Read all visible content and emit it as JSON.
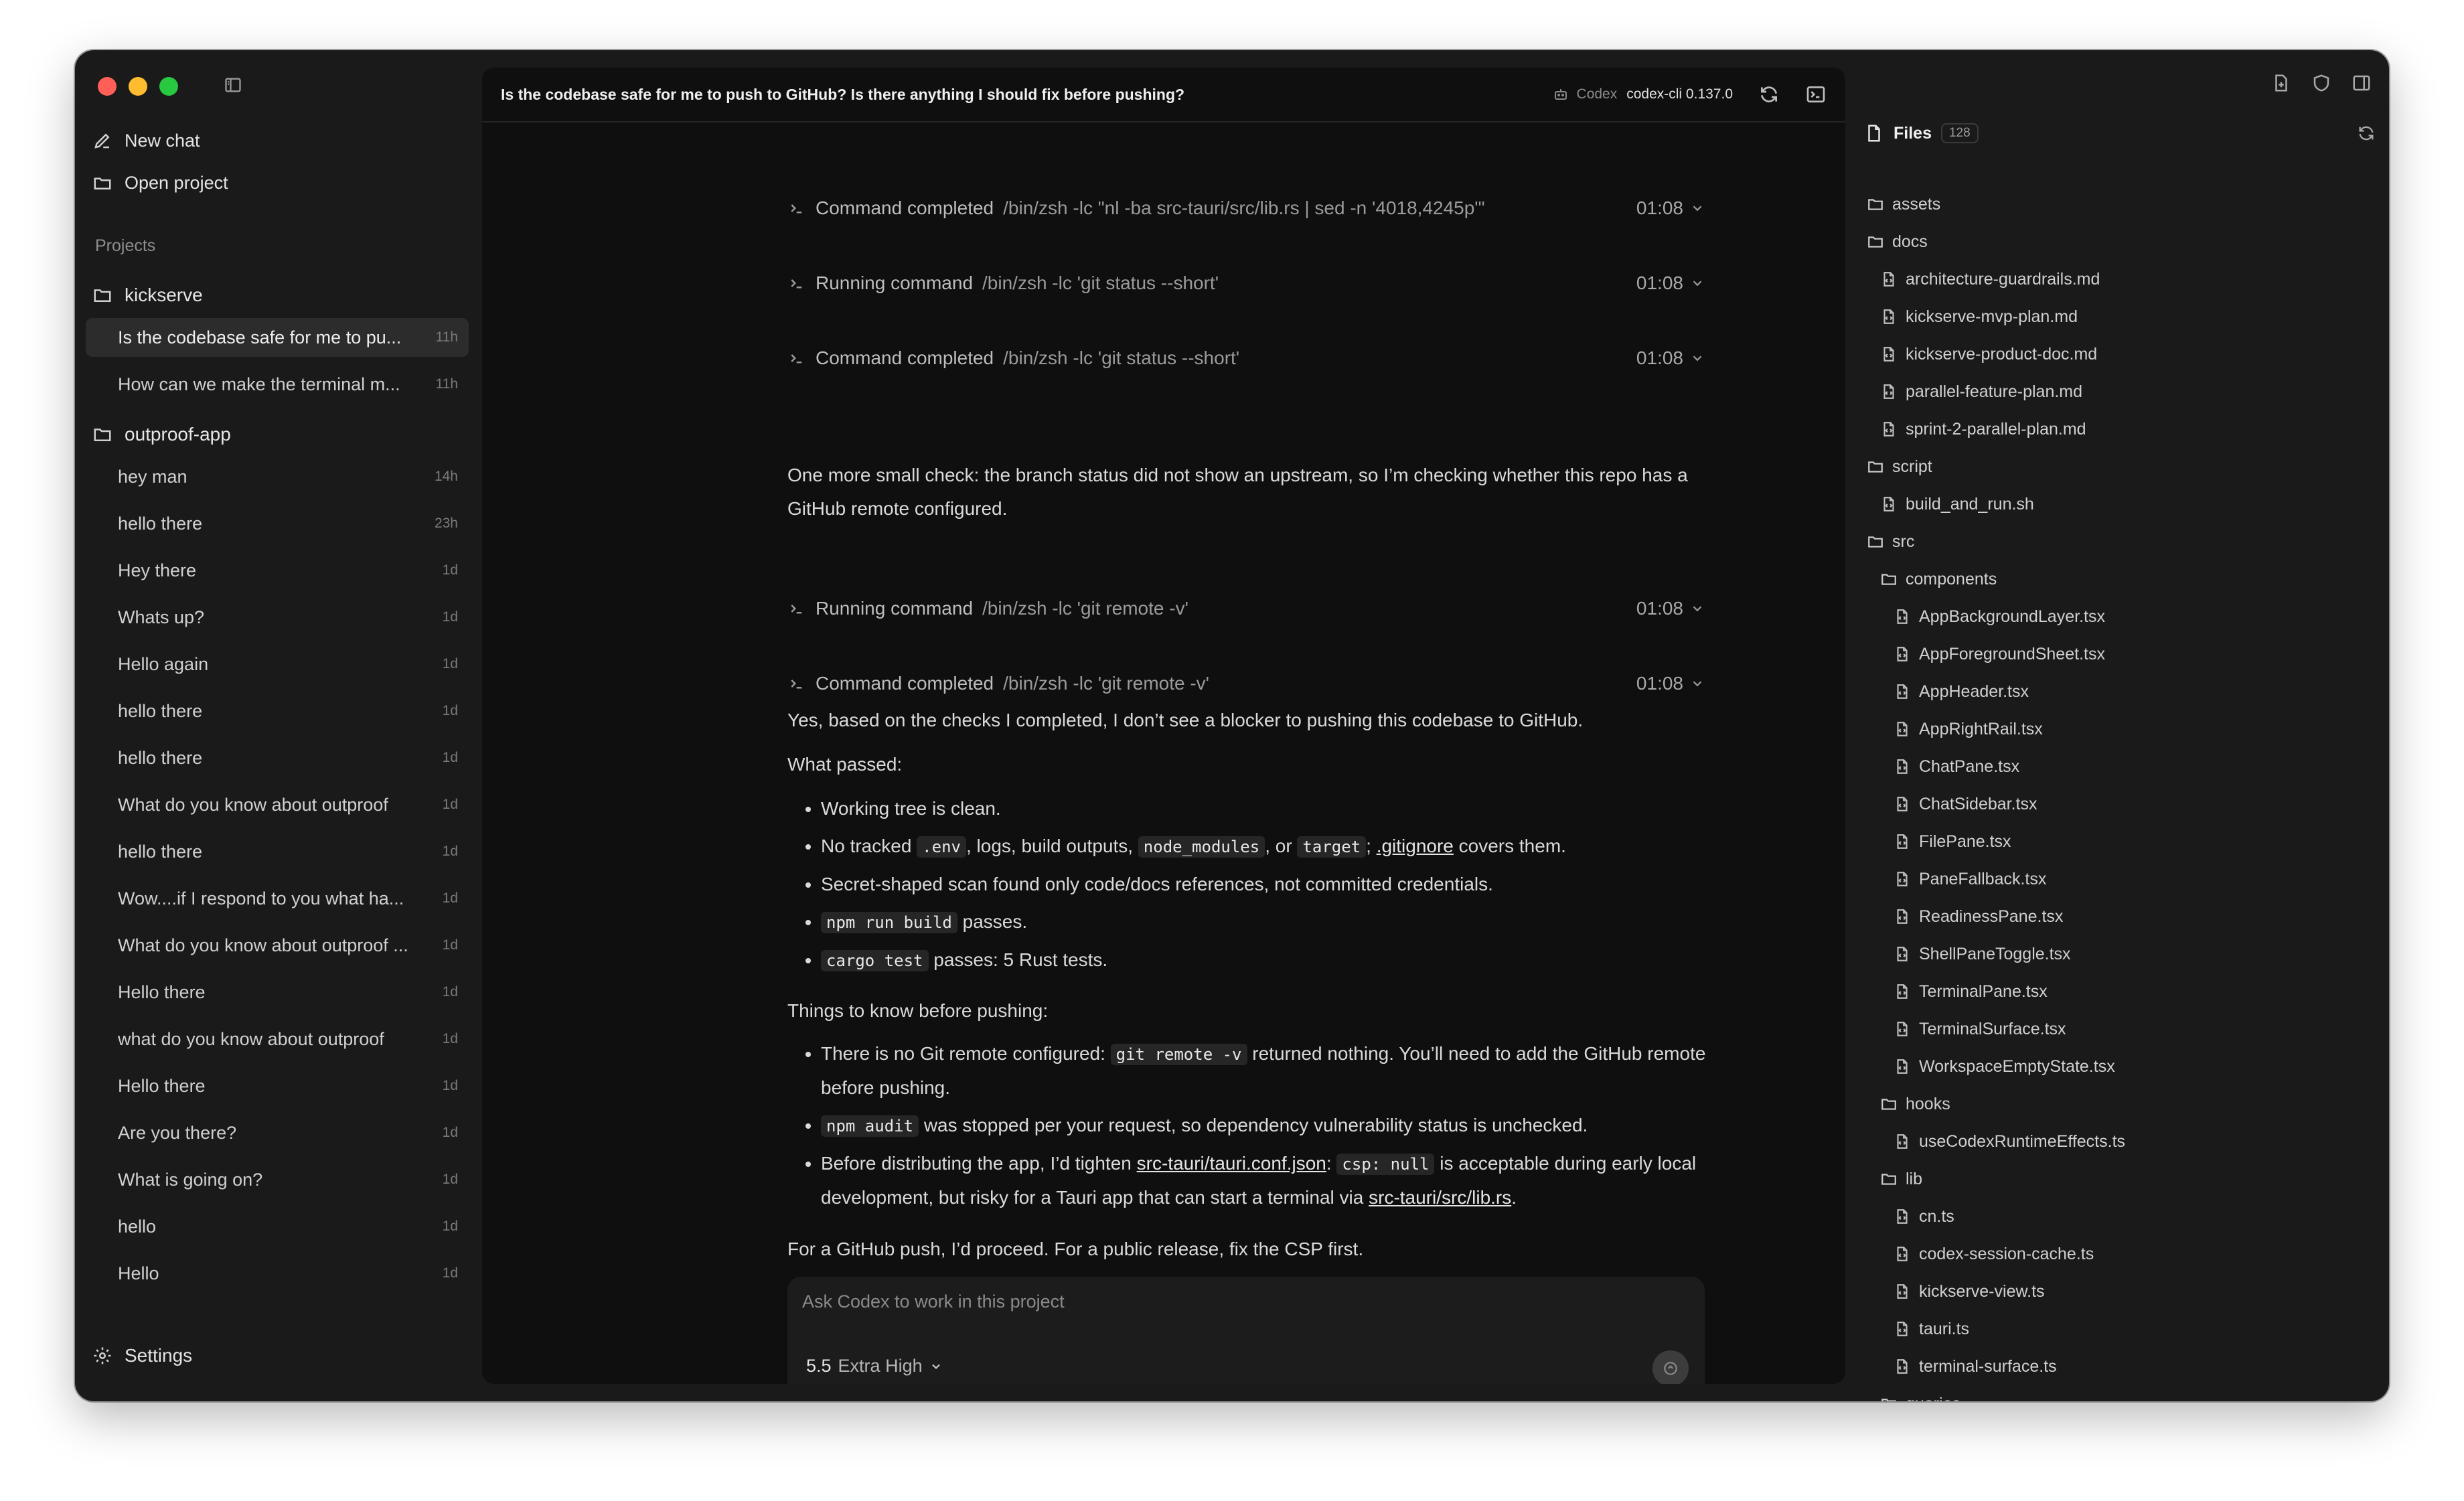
{
  "sidebar": {
    "new_chat": "New chat",
    "open_project": "Open project",
    "projects_label": "Projects",
    "settings": "Settings",
    "projects": [
      {
        "name": "kickserve",
        "chats": [
          {
            "title": "Is the codebase safe for me to pu...",
            "age": "11h",
            "active": true
          },
          {
            "title": "How can we make the terminal m...",
            "age": "11h"
          }
        ]
      },
      {
        "name": "outproof-app",
        "chats": [
          {
            "title": "hey man",
            "age": "14h"
          },
          {
            "title": "hello there",
            "age": "23h"
          },
          {
            "title": "Hey there",
            "age": "1d"
          },
          {
            "title": "Whats up?",
            "age": "1d"
          },
          {
            "title": "Hello again",
            "age": "1d"
          },
          {
            "title": "hello there",
            "age": "1d"
          },
          {
            "title": "hello there",
            "age": "1d"
          },
          {
            "title": "What do you know about outproof",
            "age": "1d"
          },
          {
            "title": "hello there",
            "age": "1d"
          },
          {
            "title": "Wow....if I respond to you what ha...",
            "age": "1d"
          },
          {
            "title": "What do you know about outproof ...",
            "age": "1d"
          },
          {
            "title": "Hello there",
            "age": "1d"
          },
          {
            "title": "what do you know about outproof",
            "age": "1d"
          },
          {
            "title": "Hello there",
            "age": "1d"
          },
          {
            "title": "Are you there?",
            "age": "1d"
          },
          {
            "title": "What is going on?",
            "age": "1d"
          },
          {
            "title": "hello",
            "age": "1d"
          },
          {
            "title": "Hello",
            "age": "1d"
          }
        ]
      }
    ]
  },
  "header": {
    "title": "Is the codebase safe for me to push to GitHub? Is there anything I should fix before pushing?",
    "codex_label": "Codex",
    "version": "codex-cli 0.137.0"
  },
  "conversation": {
    "commands": [
      {
        "state": "Command completed",
        "text": "/bin/zsh -lc \"nl -ba src-tauri/src/lib.rs | sed -n '4018,4245p'\"",
        "time": "01:08"
      },
      {
        "state": "Running command",
        "text": "/bin/zsh -lc 'git status --short'",
        "time": "01:08"
      },
      {
        "state": "Command completed",
        "text": "/bin/zsh -lc 'git status --short'",
        "time": "01:08"
      },
      {
        "state": "Running command",
        "text": "/bin/zsh -lc 'git remote -v'",
        "time": "01:08"
      },
      {
        "state": "Command completed",
        "text": "/bin/zsh -lc 'git remote -v'",
        "time": "01:08"
      }
    ],
    "para_check": "One more small check: the branch status did not show an upstream, so I’m checking whether this repo has a GitHub remote configured.",
    "para_answer": "Yes, based on the checks I completed, I don’t see a blocker to pushing this codebase to GitHub.",
    "what_passed": "What passed:",
    "passed": {
      "b1": "Working tree is clean.",
      "b2_a": "No tracked ",
      "b2_code1": ".env",
      "b2_b": ", logs, build outputs, ",
      "b2_code2": "node_modules",
      "b2_c": ", or ",
      "b2_code3": "target",
      "b2_d": "; ",
      "b2_link": ".gitignore",
      "b2_e": " covers them.",
      "b3": "Secret-shaped scan found only code/docs references, not committed credentials.",
      "b4_code": "npm run build",
      "b4_text": " passes.",
      "b5_code": "cargo test",
      "b5_text": " passes: 5 Rust tests."
    },
    "things_to_know": "Things to know before pushing:",
    "know": {
      "k1_a": "There is no Git remote configured: ",
      "k1_code": "git remote -v",
      "k1_b": " returned nothing. You’ll need to add the GitHub remote before pushing.",
      "k2_code": "npm audit",
      "k2_b": " was stopped per your request, so dependency vulnerability status is unchecked.",
      "k3_a": "Before distributing the app, I’d tighten ",
      "k3_link1": "src-tauri/tauri.conf.json",
      "k3_b": ": ",
      "k3_code": "csp: null",
      "k3_c": " is acceptable during early local development, but risky for a Tauri app that can start a terminal via ",
      "k3_link2": "src-tauri/src/lib.rs",
      "k3_d": "."
    },
    "closing": "For a GitHub push, I’d proceed. For a public release, fix the CSP first."
  },
  "composer": {
    "placeholder": "Ask Codex to work in this project",
    "model": "5.5",
    "effort": "Extra High"
  },
  "files": {
    "title": "Files",
    "count": "128",
    "tree": [
      {
        "name": "assets",
        "type": "folder",
        "depth": 0
      },
      {
        "name": "docs",
        "type": "folder",
        "depth": 0
      },
      {
        "name": "architecture-guardrails.md",
        "type": "file",
        "depth": 1
      },
      {
        "name": "kickserve-mvp-plan.md",
        "type": "file",
        "depth": 1
      },
      {
        "name": "kickserve-product-doc.md",
        "type": "file",
        "depth": 1
      },
      {
        "name": "parallel-feature-plan.md",
        "type": "file",
        "depth": 1
      },
      {
        "name": "sprint-2-parallel-plan.md",
        "type": "file",
        "depth": 1
      },
      {
        "name": "script",
        "type": "folder",
        "depth": 0
      },
      {
        "name": "build_and_run.sh",
        "type": "file",
        "depth": 1
      },
      {
        "name": "src",
        "type": "folder",
        "depth": 0
      },
      {
        "name": "components",
        "type": "folder",
        "depth": 1
      },
      {
        "name": "AppBackgroundLayer.tsx",
        "type": "file",
        "depth": 2
      },
      {
        "name": "AppForegroundSheet.tsx",
        "type": "file",
        "depth": 2
      },
      {
        "name": "AppHeader.tsx",
        "type": "file",
        "depth": 2
      },
      {
        "name": "AppRightRail.tsx",
        "type": "file",
        "depth": 2
      },
      {
        "name": "ChatPane.tsx",
        "type": "file",
        "depth": 2
      },
      {
        "name": "ChatSidebar.tsx",
        "type": "file",
        "depth": 2
      },
      {
        "name": "FilePane.tsx",
        "type": "file",
        "depth": 2
      },
      {
        "name": "PaneFallback.tsx",
        "type": "file",
        "depth": 2
      },
      {
        "name": "ReadinessPane.tsx",
        "type": "file",
        "depth": 2
      },
      {
        "name": "ShellPaneToggle.tsx",
        "type": "file",
        "depth": 2
      },
      {
        "name": "TerminalPane.tsx",
        "type": "file",
        "depth": 2
      },
      {
        "name": "TerminalSurface.tsx",
        "type": "file",
        "depth": 2
      },
      {
        "name": "WorkspaceEmptyState.tsx",
        "type": "file",
        "depth": 2
      },
      {
        "name": "hooks",
        "type": "folder",
        "depth": 1
      },
      {
        "name": "useCodexRuntimeEffects.ts",
        "type": "file",
        "depth": 2
      },
      {
        "name": "lib",
        "type": "folder",
        "depth": 1
      },
      {
        "name": "cn.ts",
        "type": "file",
        "depth": 2
      },
      {
        "name": "codex-session-cache.ts",
        "type": "file",
        "depth": 2
      },
      {
        "name": "kickserve-view.ts",
        "type": "file",
        "depth": 2
      },
      {
        "name": "tauri.ts",
        "type": "file",
        "depth": 2
      },
      {
        "name": "terminal-surface.ts",
        "type": "file",
        "depth": 2
      },
      {
        "name": "queries",
        "type": "folder",
        "depth": 1
      }
    ]
  }
}
